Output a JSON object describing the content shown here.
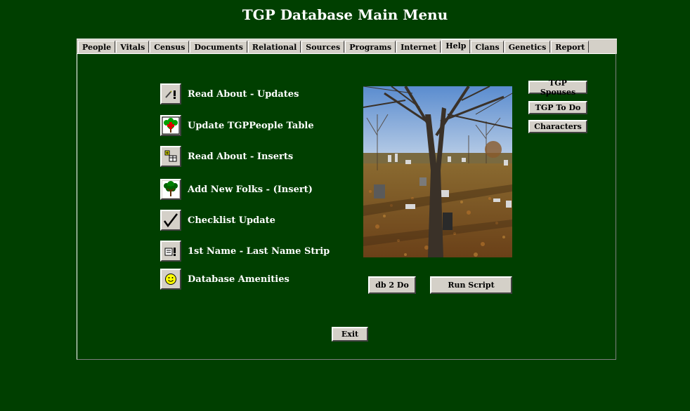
{
  "window": {
    "title": "TGP Database Main Menu"
  },
  "tabs": [
    "People",
    "Vitals",
    "Census",
    "Documents",
    "Relational",
    "Sources",
    "Programs",
    "Internet",
    "Help",
    "Clans",
    "Genetics",
    "Report"
  ],
  "active_tab": "Help",
  "menu": [
    {
      "label": "Read About - Updates",
      "icon": "pencil-exclaim-icon"
    },
    {
      "label": "Update TGPPeople Table",
      "icon": "tree-cross-icon"
    },
    {
      "label": "Read About - Inserts",
      "icon": "insert-table-icon"
    },
    {
      "label": "Add New Folks - (Insert)",
      "icon": "family-tree-icon"
    },
    {
      "label": "Checklist Update",
      "icon": "checkmark-icon"
    },
    {
      "label": "1st Name - Last Name Strip",
      "icon": "form-exclaim-icon"
    },
    {
      "label": "Database Amenities",
      "icon": "smiley-icon"
    }
  ],
  "side_buttons": [
    "TGP Spouses",
    "TGP To Do",
    "Characters"
  ],
  "bottom_buttons": {
    "db2do": "db 2 Do",
    "run_script": "Run Script"
  },
  "exit_label": "Exit",
  "colors": {
    "background": "#003f00",
    "button_face": "#d4d0c8",
    "text": "#ffffff"
  }
}
